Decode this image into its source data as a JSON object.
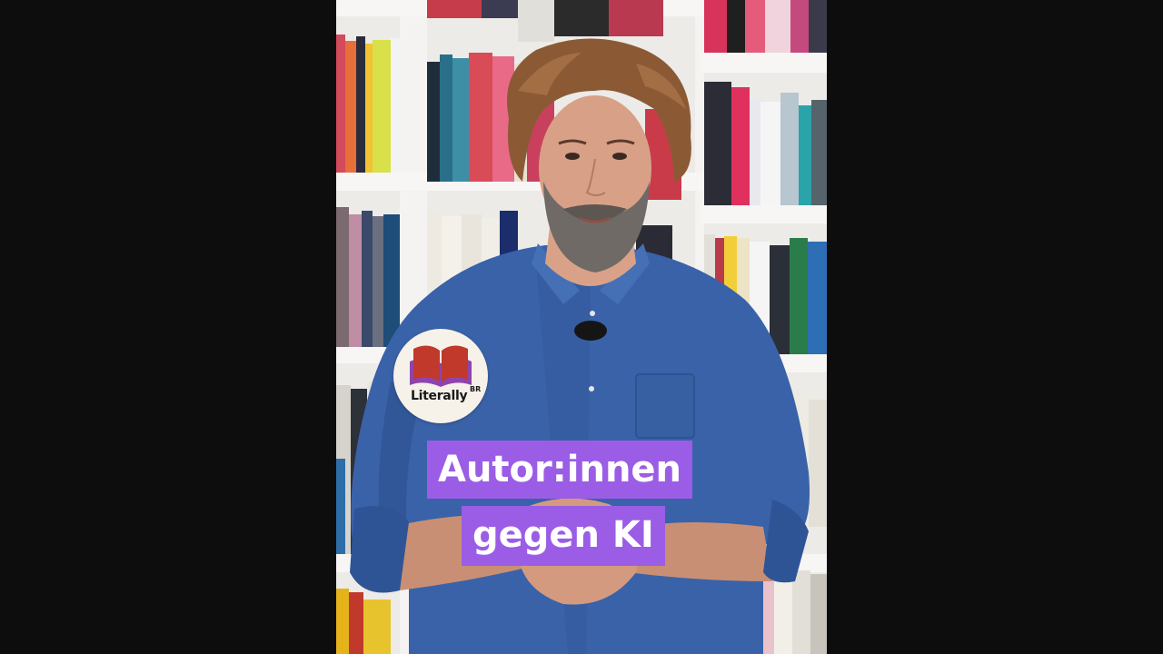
{
  "scene": {
    "description_colors": {
      "background": "#0d0d0d",
      "shelf": "#f1f0ee",
      "shirt": "#3a62a8",
      "caption_bg": "#9b5de5",
      "logo_red": "#c0392b",
      "logo_purple": "#8e44ad"
    }
  },
  "logo": {
    "name": "Literally",
    "sub": "BR"
  },
  "caption": {
    "line1": "Autor:innen",
    "line2": "gegen KI"
  }
}
